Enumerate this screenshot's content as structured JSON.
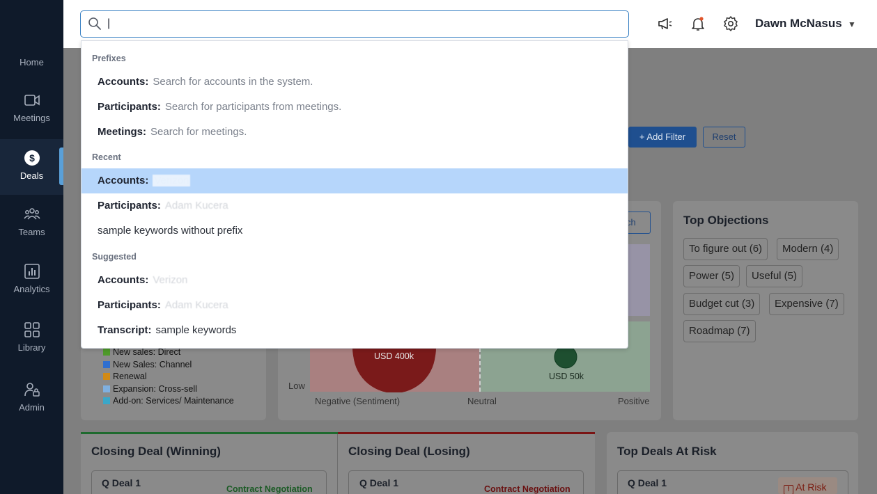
{
  "user": {
    "name": "Dawn McNasus"
  },
  "search": {
    "value": "|",
    "placeholder": ""
  },
  "sidebar": {
    "items": [
      {
        "label": "Home",
        "icon": "home-icon"
      },
      {
        "label": "Meetings",
        "icon": "video-camera-icon"
      },
      {
        "label": "Deals",
        "icon": "dollar-icon"
      },
      {
        "label": "Teams",
        "icon": "team-icon"
      },
      {
        "label": "Analytics",
        "icon": "bar-chart-icon"
      },
      {
        "label": "Library",
        "icon": "grid-icon"
      },
      {
        "label": "Admin",
        "icon": "admin-user-icon"
      }
    ],
    "active": "Deals"
  },
  "dropdown": {
    "prefixes_header": "Prefixes",
    "prefixes": [
      {
        "key": "Accounts:",
        "desc": "Search for accounts in the system."
      },
      {
        "key": "Participants:",
        "desc": "Search for participants from meetings."
      },
      {
        "key": "Meetings:",
        "desc": "Search for meetings."
      }
    ],
    "recent_header": "Recent",
    "recent": [
      {
        "key": "Accounts:",
        "value": "Verizon"
      },
      {
        "key": "Participants:",
        "value": "Adam Kucera"
      },
      {
        "key": "",
        "value": "sample keywords without prefix"
      }
    ],
    "suggested_header": "Suggested",
    "suggested": [
      {
        "key": "Accounts:",
        "value": "Verizon"
      },
      {
        "key": "Participants:",
        "value": "Adam Kucera"
      },
      {
        "key": "Transcript:",
        "value": "sample keywords"
      }
    ]
  },
  "filters": {
    "add_label": "Add Filter",
    "reset_label": "Reset",
    "search_partial": "ch"
  },
  "objections": {
    "title": "Top Objections",
    "chips": [
      "To figure out (6)",
      "Modern (4)",
      "Power (5)",
      "Useful (5)",
      "Budget cut (3)",
      "Expensive (7)",
      "Roadmap (7)"
    ]
  },
  "legend": {
    "items": [
      {
        "label": "New sales: Direct",
        "color": "#4f9a2a"
      },
      {
        "label": "New Sales: Channel",
        "color": "#2f6fd0"
      },
      {
        "label": "Renewal",
        "color": "#d28a15"
      },
      {
        "label": "Expansion: Cross-sell",
        "color": "#7fb0e0"
      },
      {
        "label": "Add-on: Services/ Maintenance",
        "color": "#3aa7c9"
      }
    ]
  },
  "sentiment_chart": {
    "low_label": "Low",
    "x_labels": [
      "Negative (Sentiment)",
      "Neutral",
      "Positive"
    ],
    "bubbles": [
      {
        "label": "USD 400k"
      },
      {
        "label": "USD 50k"
      }
    ]
  },
  "closing": {
    "winning_title": "Closing Deal (Winning)",
    "losing_title": "Closing Deal (Losing)",
    "risk_title": "Top Deals At Risk",
    "winning_deal": {
      "name": "Q Deal 1",
      "stage": "Contract Negotiation"
    },
    "losing_deal": {
      "name": "Q Deal 1",
      "stage": "Contract Negotiation"
    },
    "risk_deal": {
      "name": "Q Deal 1",
      "badge": "At Risk"
    }
  },
  "colors": {
    "accent": "#3b82c4",
    "highlight": "#b6d6fb",
    "sidebar": "#0f1a2a"
  }
}
